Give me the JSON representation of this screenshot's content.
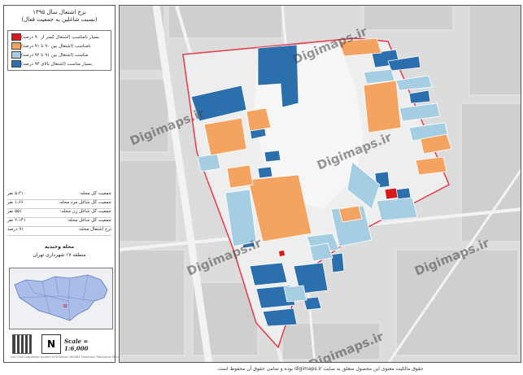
{
  "sidebar": {
    "title_line1": "نرخ اشتغال سال ۱۳۹۵",
    "title_line2": "(نسبت شاغلین به جمعیت فعال)",
    "legend": [
      {
        "label": "بسیار نامناسب (اشتغال کمتر از ۹۰ درصد)",
        "color": "#d7191c"
      },
      {
        "label": "نامناسب (اشتغال بین ۹۰ تا ۹۱ درصد)",
        "color": "#f4a460"
      },
      {
        "label": "مناسب (اشتغال بین ۹۱ تا ۹۲ درصد)",
        "color": "#a6cee3"
      },
      {
        "label": "بسیار مناسب (اشتغال بالای ۹۴ درصد)",
        "color": "#2c6fad"
      }
    ],
    "stats": [
      {
        "label": "جمعیت کل محله:",
        "value": "۵،۲۱۰ نفر"
      },
      {
        "label": "جمعیت کل شاغل مرد محله:",
        "value": "۱،۶۶ نفر"
      },
      {
        "label": "جمعیت کل شاغل زن محله:",
        "value": "۵۵۱ نفر"
      },
      {
        "label": "جمعیت کل شاغل محله:",
        "value": "۲،۱۴۱ نفر"
      },
      {
        "label": "نرخ اشتغال محله:",
        "value": "۹۱ درصد"
      }
    ],
    "place_line1": "محله وحیدیه",
    "place_line2": "منطقه ۱۷ شهرداری تهران",
    "scale": "Scale = 1:6,000",
    "credit": "Iran Grid Coordinate System UTM Datum WGS84 Projection Transverse Mercator"
  },
  "map": {
    "watermark": "Digimaps.ir"
  },
  "footer": {
    "text": "حقوق مالکیت معنوی این محصول متعلق به سایت digimaps.ir بوده و تمامی حقوق آن محفوظ است."
  },
  "colors": {
    "very_poor": "#d7191c",
    "poor": "#f4a460",
    "good": "#a6cee3",
    "very_good": "#2c6fad",
    "boundary": "#e8394a",
    "road": "#f5f5f5",
    "background": "#dedede"
  }
}
